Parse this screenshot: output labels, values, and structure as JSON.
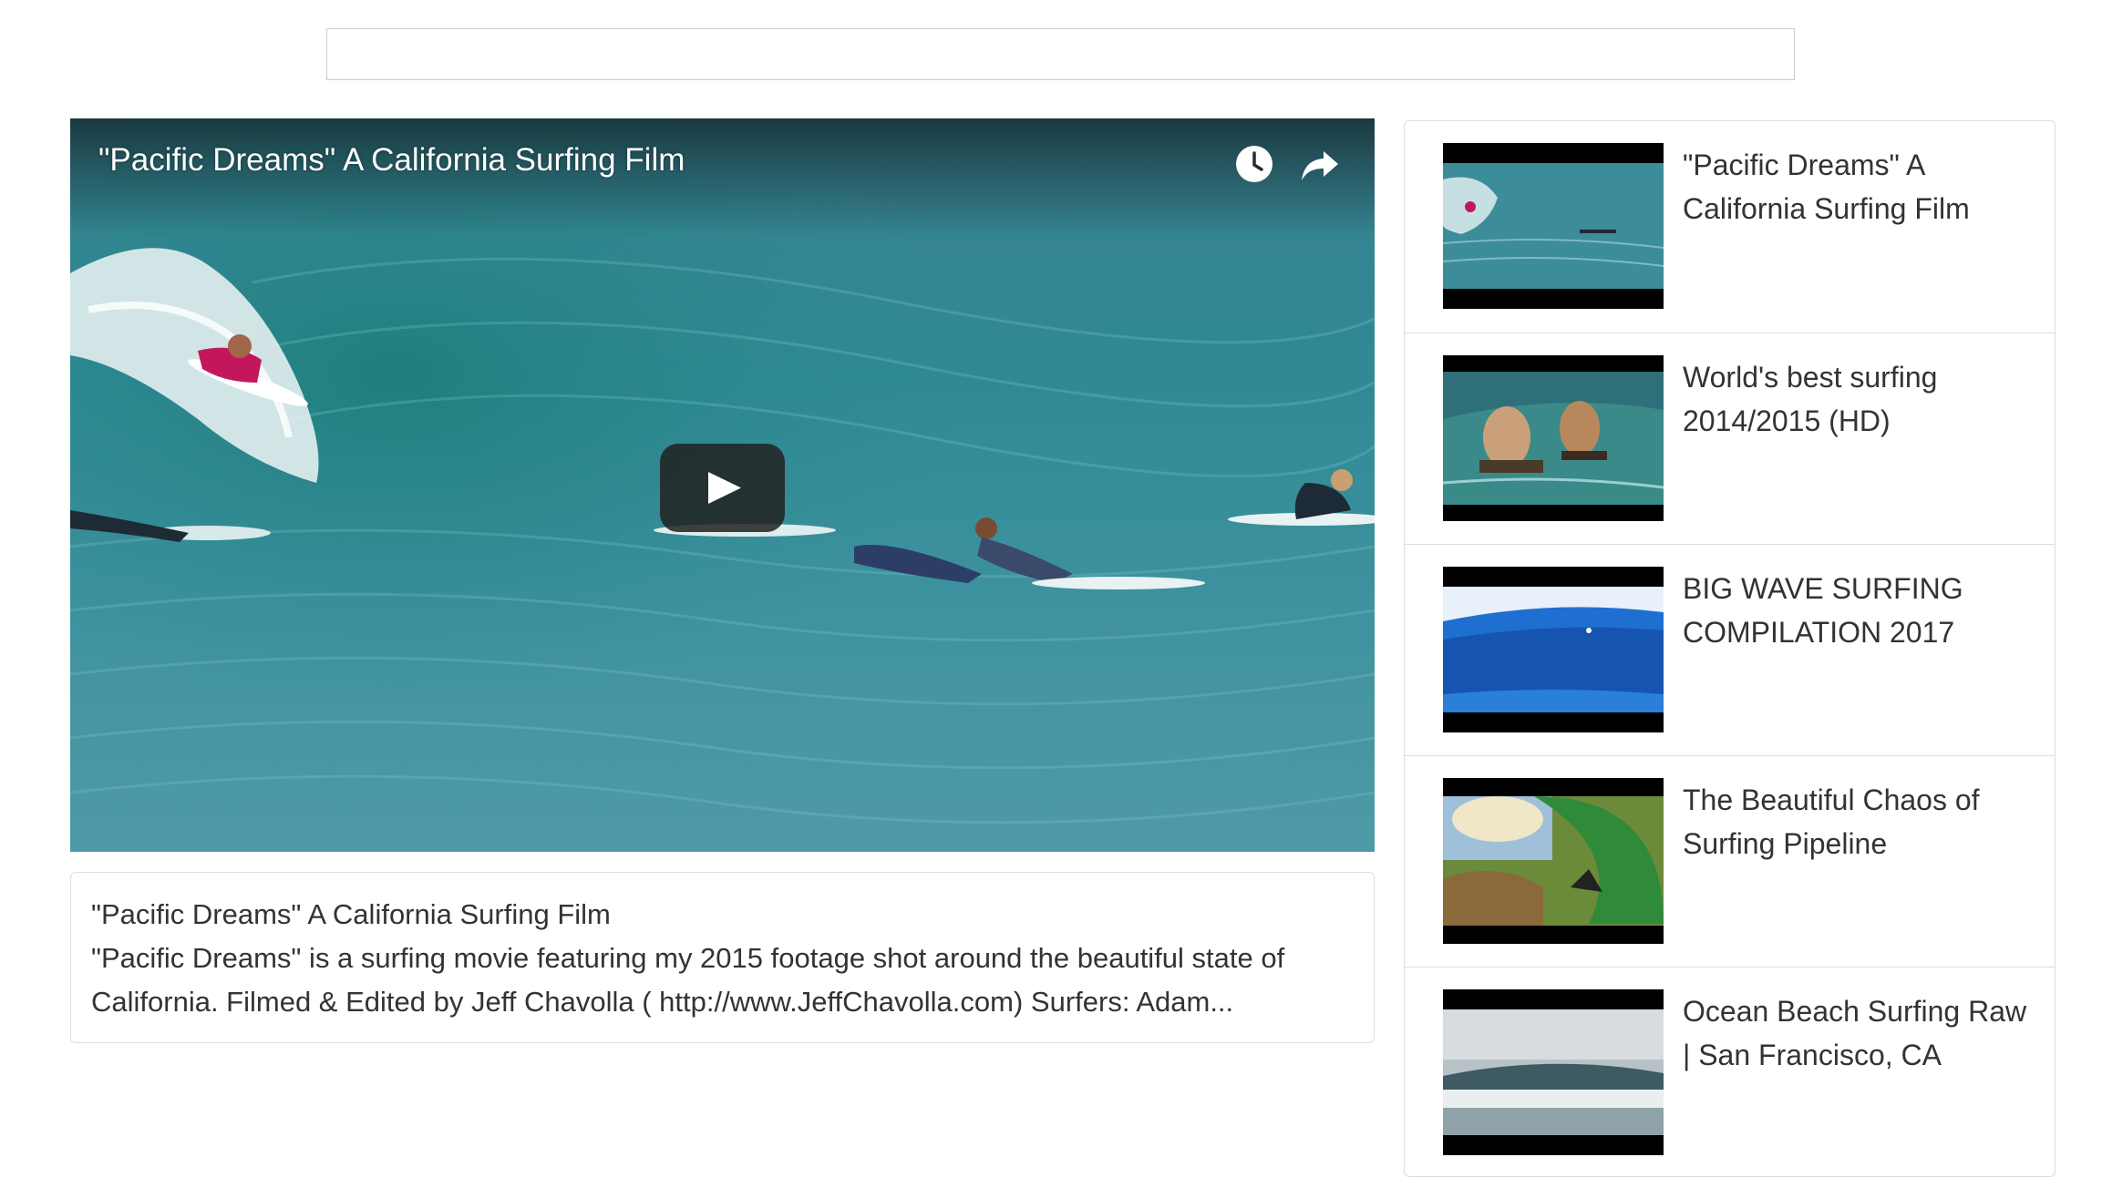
{
  "search": {
    "value": "",
    "placeholder": ""
  },
  "player": {
    "title": "\"Pacific Dreams\" A California Surfing Film",
    "icons": {
      "watch_later": "clock-icon",
      "share": "share-arrow-icon",
      "play": "play-icon"
    }
  },
  "description": {
    "title": "\"Pacific Dreams\" A California Surfing Film",
    "body": "\"Pacific Dreams\" is a surfing movie featuring my 2015 footage shot around the beautiful state of California. Filmed & Edited by Jeff Chavolla ( http://www.JeffChavolla.com) Surfers: Adam..."
  },
  "videos": [
    {
      "title": "\"Pacific Dreams\" A California Surfing Film"
    },
    {
      "title": "World's best surfing 2014/2015 (HD)"
    },
    {
      "title": "BIG WAVE SURFING COMPILATION 2017"
    },
    {
      "title": "The Beautiful Chaos of Surfing Pipeline"
    },
    {
      "title": "Ocean Beach Surfing Raw | San Francisco, CA"
    }
  ],
  "colors": {
    "border": "#dddddd",
    "text": "#333333",
    "ocean": "#2d7d8c",
    "play_button_bg": "#212121"
  }
}
